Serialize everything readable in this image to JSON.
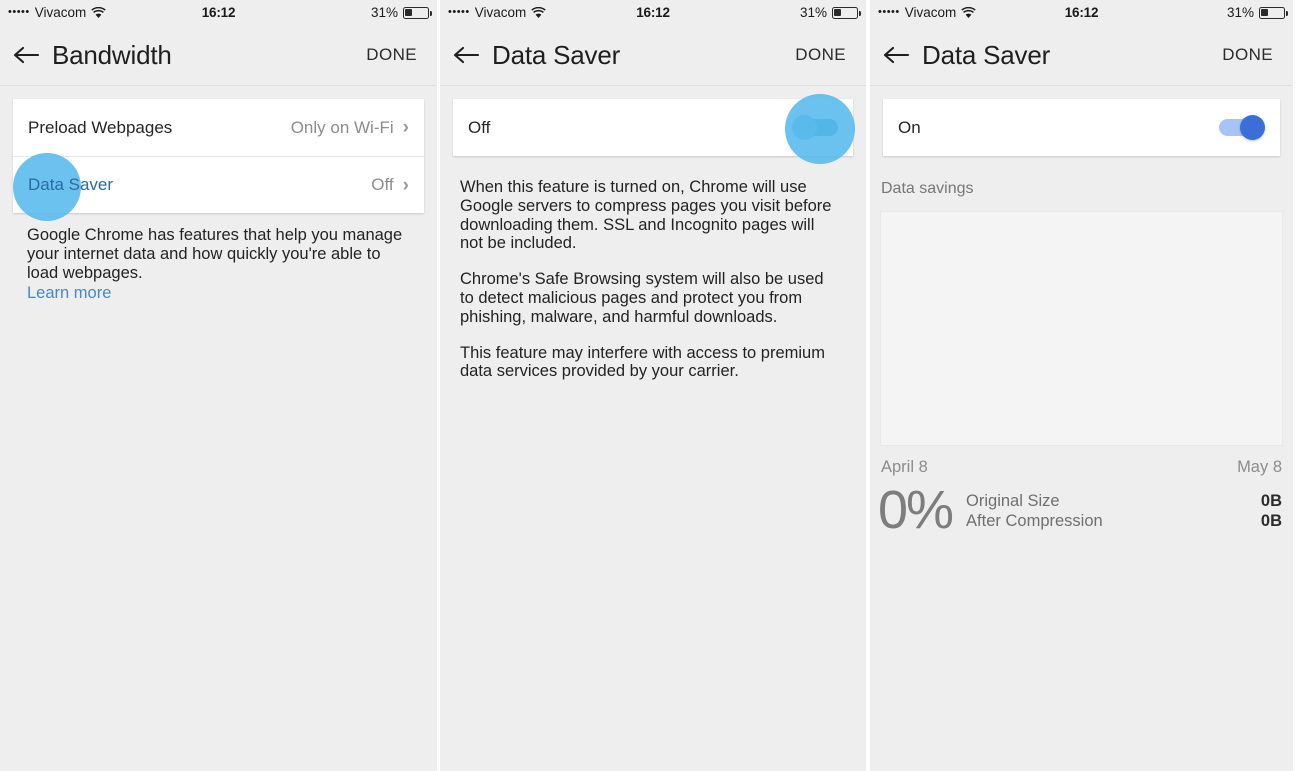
{
  "status_bar": {
    "signal_dots": "•••••",
    "carrier": "Vivacom",
    "wifi_icon": "wifi-icon",
    "time": "16:12",
    "battery_percent": "31%",
    "battery_icon": "battery-icon",
    "battery_level": 31
  },
  "panels": [
    {
      "nav": {
        "back_icon": "back-arrow-icon",
        "title": "Bandwidth",
        "done_label": "DONE"
      },
      "rows": [
        {
          "label": "Preload Webpages",
          "value": "Only on Wi-Fi",
          "chevron": "›"
        },
        {
          "label": "Data Saver",
          "value": "Off",
          "chevron": "›"
        }
      ],
      "description": "Google Chrome has features that help you manage your internet data and how quickly you're able to load webpages.",
      "learn_more": "Learn more",
      "tap_indicator": "tap-highlight-circle"
    },
    {
      "nav": {
        "back_icon": "back-arrow-icon",
        "title": "Data Saver",
        "done_label": "DONE"
      },
      "toggle": {
        "label": "Off",
        "state": "off"
      },
      "paragraphs": [
        "When this feature is turned on, Chrome will use Google servers to compress pages you visit before downloading them. SSL and Incognito pages will not be included.",
        "Chrome's Safe Browsing system will also be used to detect malicious pages and protect you from phishing, malware, and harmful downloads.",
        "This feature may interfere with access to premium data services provided by your carrier."
      ],
      "tap_indicator": "tap-highlight-circle"
    },
    {
      "nav": {
        "back_icon": "back-arrow-icon",
        "title": "Data Saver",
        "done_label": "DONE"
      },
      "toggle": {
        "label": "On",
        "state": "on"
      },
      "savings_label": "Data savings",
      "date_start": "April 8",
      "date_end": "May 8",
      "percent": "0%",
      "stats": [
        {
          "name": "Original Size",
          "value": "0B"
        },
        {
          "name": "After Compression",
          "value": "0B"
        }
      ]
    }
  ],
  "colors": {
    "accent_blue": "#57b9ec",
    "toggle_on_blue": "#3a6fd8",
    "link_blue": "#4a87c8",
    "bg_gray": "#eeeeee",
    "card_white": "#ffffff"
  },
  "chart_data": {
    "type": "bar",
    "title": "Data savings",
    "categories": [],
    "values": [],
    "xlabel": "",
    "ylabel": "",
    "x_range_start": "April 8",
    "x_range_end": "May 8",
    "note": "Empty chart — no data savings recorded (0%)",
    "grid": false,
    "legend": "none"
  }
}
